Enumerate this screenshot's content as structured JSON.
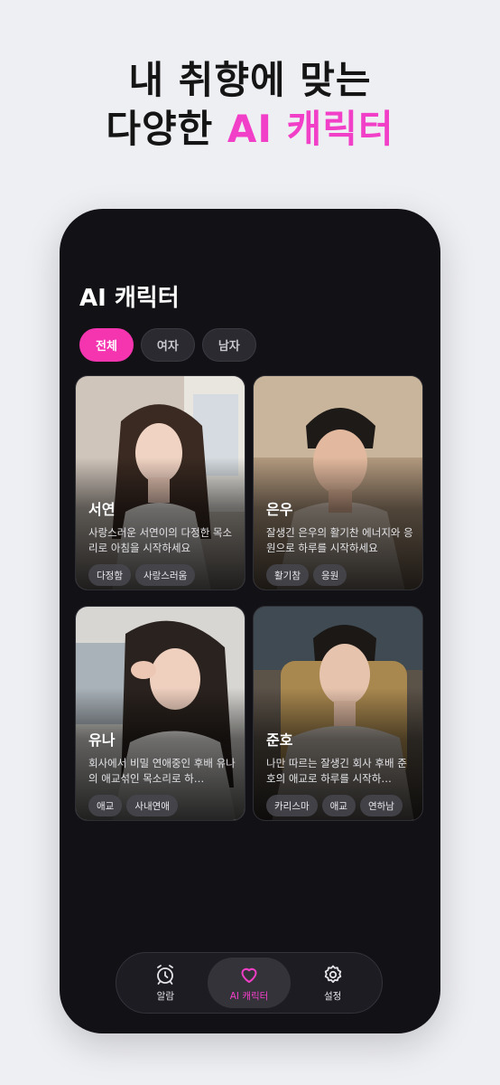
{
  "headline": {
    "line1": "내 취향에 맞는",
    "line2_prefix": "다양한 ",
    "line2_accent": "AI 캐릭터"
  },
  "screen": {
    "title": "AI 캐릭터"
  },
  "filters": [
    {
      "label": "전체",
      "active": true
    },
    {
      "label": "여자",
      "active": false
    },
    {
      "label": "남자",
      "active": false
    }
  ],
  "characters": [
    {
      "name": "서연",
      "desc": "사랑스러운 서연이의 다정한 목소리로 아침을 시작하세요",
      "tags": [
        "다정함",
        "사랑스러움"
      ]
    },
    {
      "name": "은우",
      "desc": "잘생긴 은우의 활기찬 에너지와 응원으로 하루를 시작하세요",
      "tags": [
        "활기참",
        "응원"
      ]
    },
    {
      "name": "유나",
      "desc": "회사에서 비밀 연애중인 후배 유나의 애교섞인 목소리로 하…",
      "tags": [
        "애교",
        "사내연애"
      ]
    },
    {
      "name": "준호",
      "desc": "나만 따르는 잘생긴 회사 후배 준호의 애교로 하루를 시작하…",
      "tags": [
        "카리스마",
        "애교",
        "연하남"
      ]
    }
  ],
  "tabbar": [
    {
      "label": "알람",
      "icon": "alarm-clock-icon",
      "active": false
    },
    {
      "label": "AI 캐릭터",
      "icon": "heart-icon",
      "active": true
    },
    {
      "label": "설정",
      "icon": "gear-icon",
      "active": false
    }
  ],
  "colors": {
    "accent": "#f23fc8",
    "chip_active": "#f534b0",
    "phone_bg": "#121116",
    "page_bg": "#eeeff3"
  }
}
